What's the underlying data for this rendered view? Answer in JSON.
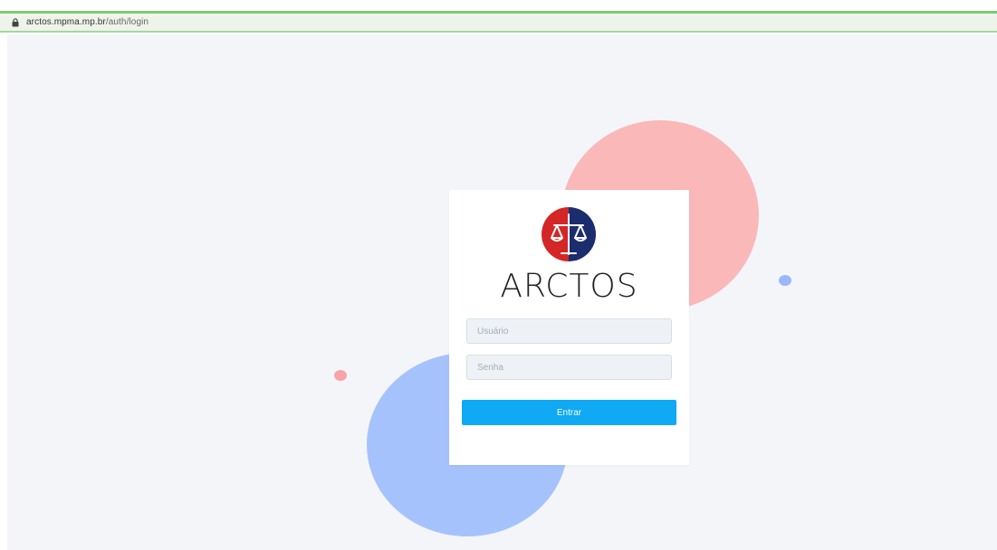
{
  "browser": {
    "url_host": "arctos.mpma.mp.br",
    "url_path": "/auth/login",
    "lock_icon": "lock-icon"
  },
  "login": {
    "brand": "ARCTOS",
    "logo_icon": "scales-of-justice-icon",
    "username_placeholder": "Usuário",
    "password_placeholder": "Senha",
    "submit_label": "Entrar"
  },
  "colors": {
    "button": "#0fa9f4",
    "logo_left": "#d42626",
    "logo_right": "#1c2d6e",
    "deco_pink": "#fab8b9",
    "deco_blue": "#a6c2fc",
    "background": "#f3f5f8"
  }
}
